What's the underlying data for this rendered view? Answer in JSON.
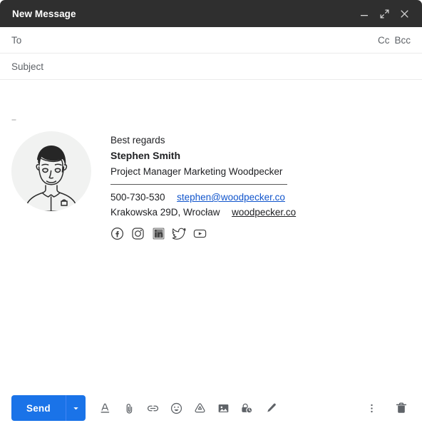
{
  "window": {
    "title": "New Message",
    "controls": [
      {
        "name": "minimize",
        "icon": "minimize-icon",
        "label": "Minimize"
      },
      {
        "name": "expand",
        "icon": "expand-icon",
        "label": "Full screen"
      },
      {
        "name": "close",
        "icon": "close-icon",
        "label": "Save & close"
      }
    ]
  },
  "fields": {
    "to_label": "To",
    "to_value": "",
    "cc_label": "Cc",
    "bcc_label": "Bcc",
    "subject_label": "Subject",
    "subject_value": ""
  },
  "body": {
    "signature_delimiter": "--",
    "avatar_alt": "portrait-illustration"
  },
  "signature": {
    "regards": "Best regards",
    "name": "Stephen Smith",
    "role": "Project Manager  Marketing  Woodpecker",
    "phone": "500-730-530",
    "email": "stephen@woodpecker.co",
    "address": "Krakowska 29D, Wrocław",
    "website": "woodpecker.co",
    "social": [
      {
        "name": "facebook",
        "icon": "facebook-icon"
      },
      {
        "name": "instagram",
        "icon": "instagram-icon"
      },
      {
        "name": "linkedin",
        "icon": "linkedin-icon"
      },
      {
        "name": "twitter",
        "icon": "twitter-icon"
      },
      {
        "name": "youtube",
        "icon": "youtube-icon"
      }
    ]
  },
  "footer": {
    "send_label": "Send",
    "send_caret_icon": "chevron-down-icon",
    "tools": [
      {
        "name": "formatting-options",
        "icon": "format-text-icon"
      },
      {
        "name": "attach-files",
        "icon": "paperclip-icon"
      },
      {
        "name": "insert-link",
        "icon": "link-icon"
      },
      {
        "name": "insert-emoji",
        "icon": "emoji-icon"
      },
      {
        "name": "insert-drive-file",
        "icon": "google-drive-icon"
      },
      {
        "name": "insert-photo",
        "icon": "image-icon"
      },
      {
        "name": "confidential-mode",
        "icon": "lock-clock-icon"
      },
      {
        "name": "insert-signature",
        "icon": "pen-icon"
      }
    ],
    "more_options_icon": "more-vertical-icon",
    "discard_icon": "trash-icon"
  },
  "colors": {
    "header_bg": "#2f2f2f",
    "send_blue": "#1a73e8",
    "link_blue": "#1155cc",
    "text_primary": "#202124",
    "text_secondary": "#5f6368"
  }
}
